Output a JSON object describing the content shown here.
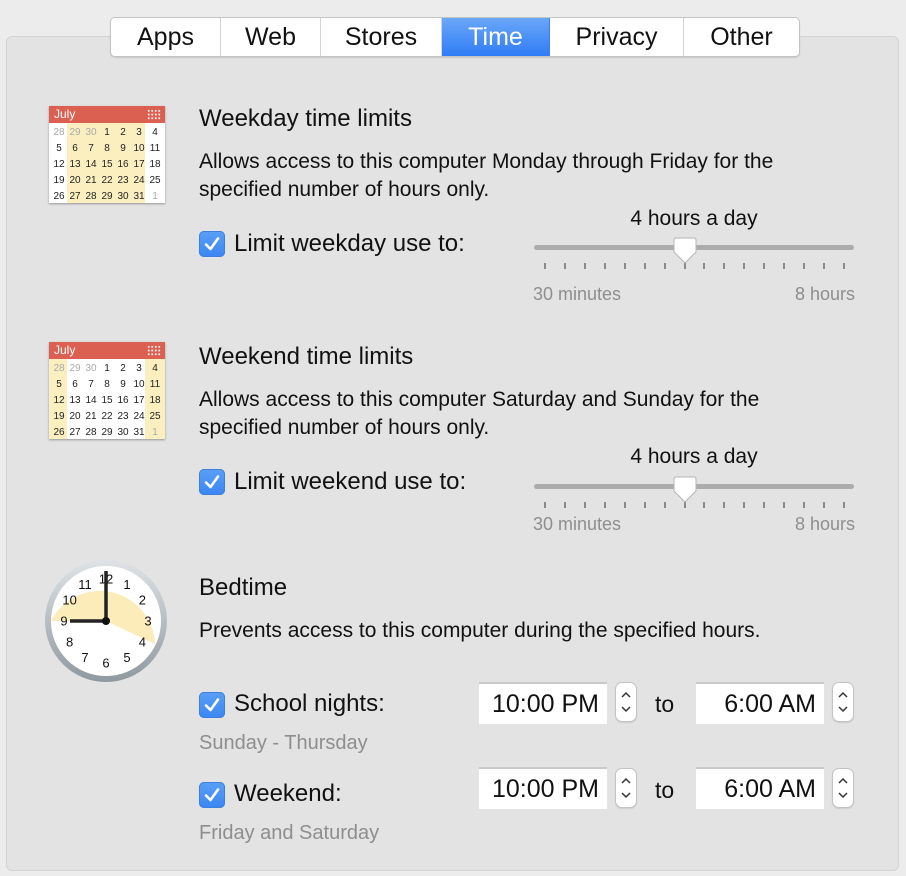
{
  "tabs": [
    {
      "label": "Apps",
      "active": false
    },
    {
      "label": "Web",
      "active": false
    },
    {
      "label": "Stores",
      "active": false
    },
    {
      "label": "Time",
      "active": true
    },
    {
      "label": "Privacy",
      "active": false
    },
    {
      "label": "Other",
      "active": false
    }
  ],
  "weekday": {
    "icon": "calendar-weekday-icon",
    "calendar_month": "July",
    "title": "Weekday time limits",
    "description_line1": "Allows access to this computer Monday through Friday for the",
    "description_line2": "specified number of hours only.",
    "checkbox_label": "Limit weekday use to:",
    "checked": true,
    "slider": {
      "value_label": "4 hours a day",
      "min_label": "30 minutes",
      "max_label": "8 hours",
      "min_hours": 0.5,
      "max_hours": 8,
      "step_hours": 0.5,
      "value_hours": 4
    }
  },
  "weekend": {
    "icon": "calendar-weekend-icon",
    "calendar_month": "July",
    "title": "Weekend time limits",
    "description_line1": "Allows access to this computer Saturday and Sunday for the",
    "description_line2": "specified number of hours only.",
    "checkbox_label": "Limit weekend use to:",
    "checked": true,
    "slider": {
      "value_label": "4 hours a day",
      "min_label": "30 minutes",
      "max_label": "8 hours",
      "min_hours": 0.5,
      "max_hours": 8,
      "step_hours": 0.5,
      "value_hours": 4
    }
  },
  "calendar_days": [
    "28",
    "29",
    "30",
    "1",
    "2",
    "3",
    "4",
    "5",
    "6",
    "7",
    "8",
    "9",
    "10",
    "11",
    "12",
    "13",
    "14",
    "15",
    "16",
    "17",
    "18",
    "19",
    "20",
    "21",
    "22",
    "23",
    "24",
    "25",
    "26",
    "27",
    "28",
    "29",
    "30",
    "31",
    "1"
  ],
  "bedtime": {
    "icon": "clock-icon",
    "clock_numbers": [
      "12",
      "1",
      "2",
      "3",
      "4",
      "5",
      "6",
      "7",
      "8",
      "9",
      "10",
      "11"
    ],
    "title": "Bedtime",
    "description": "Prevents access to this computer during the specified hours.",
    "school_nights": {
      "label": "School nights:",
      "checked": true,
      "days": "Sunday - Thursday",
      "from": "10:00 PM",
      "to": "6:00 AM"
    },
    "weekend": {
      "label": "Weekend:",
      "checked": true,
      "days": "Friday and Saturday",
      "from": "10:00 PM",
      "to": "6:00 AM"
    },
    "to_label": "to"
  },
  "colors": {
    "accent": "#3a86f2",
    "calendar_header": "#dc6051",
    "highlight": "#fbefbf"
  }
}
